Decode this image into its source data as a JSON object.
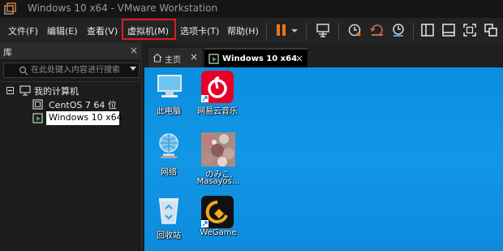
{
  "window": {
    "title": "Windows 10 x64 - VMware Workstation"
  },
  "menu": [
    {
      "label": "文件(F)"
    },
    {
      "label": "编辑(E)"
    },
    {
      "label": "查看(V)"
    },
    {
      "label": "虚拟机(M)",
      "highlighted": true
    },
    {
      "label": "选项卡(T)"
    },
    {
      "label": "帮助(H)"
    }
  ],
  "toolbar": {
    "buttons": [
      "pause-icon",
      "dropdown-icon",
      "send-ctrl-alt-del-icon",
      "snapshot-icon",
      "revert-snapshot-icon",
      "snapshot-manager-icon",
      "show-library-icon",
      "thumbnail-bar-icon",
      "full-screen-icon",
      "unity-icon"
    ]
  },
  "library": {
    "title": "库",
    "close": "×",
    "search_placeholder": "在此处键入内容进行搜索",
    "root": {
      "label": "我的计算机",
      "expander": "−"
    },
    "vms": [
      {
        "label": "CentOS 7 64 位",
        "selected": false
      },
      {
        "label": "Windows 10 x64",
        "selected": true
      }
    ]
  },
  "tabs": [
    {
      "label": "主页",
      "close": "×"
    },
    {
      "label": "Windows 10 x64",
      "close": "×",
      "active": true
    }
  ],
  "desktop": {
    "icons": [
      {
        "label": "此电脑"
      },
      {
        "label": "网易云音乐"
      },
      {
        "label": "网络"
      },
      {
        "label_line1": "のみこ,",
        "label_line2": "Masayos..."
      },
      {
        "label": "回收站"
      },
      {
        "label": "WeGame"
      }
    ]
  },
  "colors": {
    "accent_red": "#e01b1b",
    "pause_orange": "#e8761c",
    "desktop_blue": "#0a8fde",
    "netease_red": "#e60026"
  }
}
